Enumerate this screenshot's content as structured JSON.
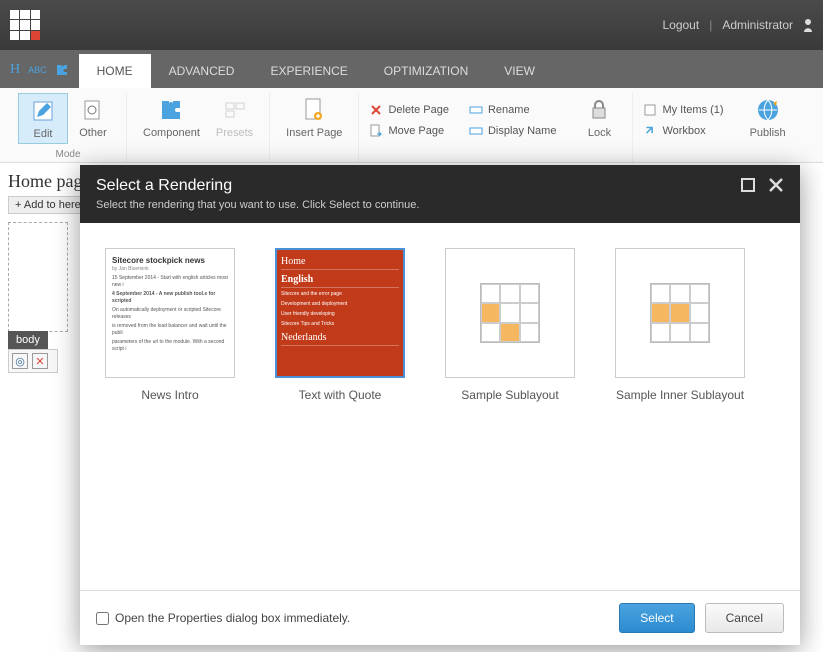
{
  "header": {
    "logout": "Logout",
    "user": "Administrator"
  },
  "tabs": {
    "home": "HOME",
    "advanced": "ADVANCED",
    "experience": "EXPERIENCE",
    "optimization": "OPTIMIZATION",
    "view": "VIEW"
  },
  "ribbon": {
    "edit": "Edit",
    "other": "Other",
    "mode_group": "Mode",
    "component": "Component",
    "presets": "Presets",
    "insert_page": "Insert Page",
    "delete_page": "Delete Page",
    "rename": "Rename",
    "move_page": "Move Page",
    "display_name": "Display Name",
    "lock": "Lock",
    "my_items": "My Items (1)",
    "workbox": "Workbox",
    "publish": "Publish"
  },
  "page": {
    "title": "Home page",
    "add_here": "+  Add to here",
    "body_tag": "body"
  },
  "modal": {
    "title": "Select a Rendering",
    "subtitle": "Select the rendering that you want to use. Click Select to continue.",
    "renderings": {
      "news_intro": "News Intro",
      "text_with_quote": "Text with Quote",
      "sample_sublayout": "Sample Sublayout",
      "sample_inner_sublayout": "Sample Inner Sublayout"
    },
    "open_props": "Open the Properties dialog box immediately.",
    "select_btn": "Select",
    "cancel_btn": "Cancel"
  },
  "thumb_news": {
    "title": "Sitecore stockpick news",
    "auth": "by Jan Bluemink",
    "l1": "15 September 2014 - Start with english articles most new i",
    "l2": "4 September 2014 - A new publish tool.s for scripted",
    "l3": "On automatically deployment or scripted Sitecore releases",
    "l4": "is removed from the load balancer and wait until the publi",
    "l5": "parameters of the url to the module. With a second script i"
  },
  "thumb_quote": {
    "home": "Home",
    "english": "English",
    "l1": "Sitecore and the error page",
    "l2": "Development and deployment",
    "l3": "User friendly developing",
    "l4": "Sitecore Tips and Tricks",
    "nederlands": "Nederlands"
  }
}
